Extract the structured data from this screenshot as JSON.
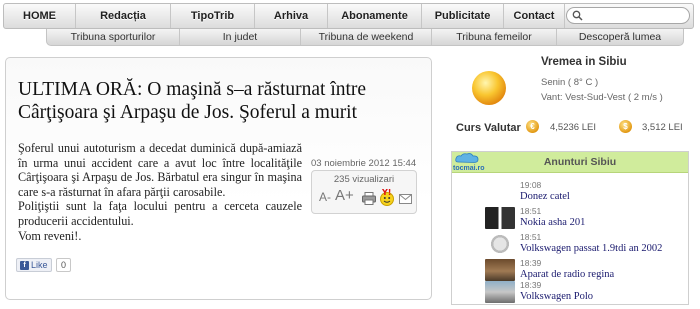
{
  "nav": {
    "items": [
      "HOME",
      "Redacția",
      "TipoTrib",
      "Arhiva",
      "Abonamente",
      "Publicitate",
      "Contact"
    ],
    "search_placeholder": ""
  },
  "subnav": {
    "items": [
      "Tribuna sporturilor",
      "In judet",
      "Tribuna de weekend",
      "Tribuna femeilor",
      "Descoperă lumea"
    ]
  },
  "article": {
    "title": "ULTIMA ORĂ: O maşină s–a răsturnat între Cârţişoara şi Arpaşu de Jos. Şoferul a murit",
    "paragraphs": [
      "Şoferul unui autoturism a decedat duminică după-amiază în urma unui accident care a avut loc între localităţile Cârţişoara şi Arpaşu de Jos. Bărbatul era singur în maşina care s-a răsturnat în afara părţii carosabile.",
      "Poliţiştii sunt la faţa locului pentru a cerceta cauzele producerii accidentului.",
      "Vom reveni!."
    ],
    "date": "03 noiembrie 2012 15:44",
    "views": "235 vizualizari",
    "font_smaller": "A-",
    "font_larger": "A+",
    "like_label": "Like",
    "like_count": "0"
  },
  "weather": {
    "title": "Vremea in Sibiu",
    "condition": "Senin ( 8° C )",
    "wind": "Vant: Vest-Sud-Vest ( 2 m/s )",
    "icon": "sun-icon"
  },
  "currency": {
    "label": "Curs Valutar",
    "euro_symbol": "€",
    "euro_value": "4,5236 LEI",
    "usd_symbol": "$",
    "usd_value": "3,512 LEI"
  },
  "ads": {
    "title": "Anunturi Sibiu",
    "logo_text": "tocmai.ro",
    "items": [
      {
        "time": "19:08",
        "title": "Donez catel"
      },
      {
        "time": "18:51",
        "title": "Nokia asha 201"
      },
      {
        "time": "18:51",
        "title": "Volkswagen passat 1.9tdi an 2002"
      },
      {
        "time": "18:39",
        "title": "Aparat de radio regina"
      },
      {
        "time": "18:39",
        "title": "Volkswagen Polo"
      }
    ]
  },
  "colors": {
    "ads_header": "#d0ec9c",
    "link": "#1a1a6e",
    "coin": "#e39a15"
  }
}
